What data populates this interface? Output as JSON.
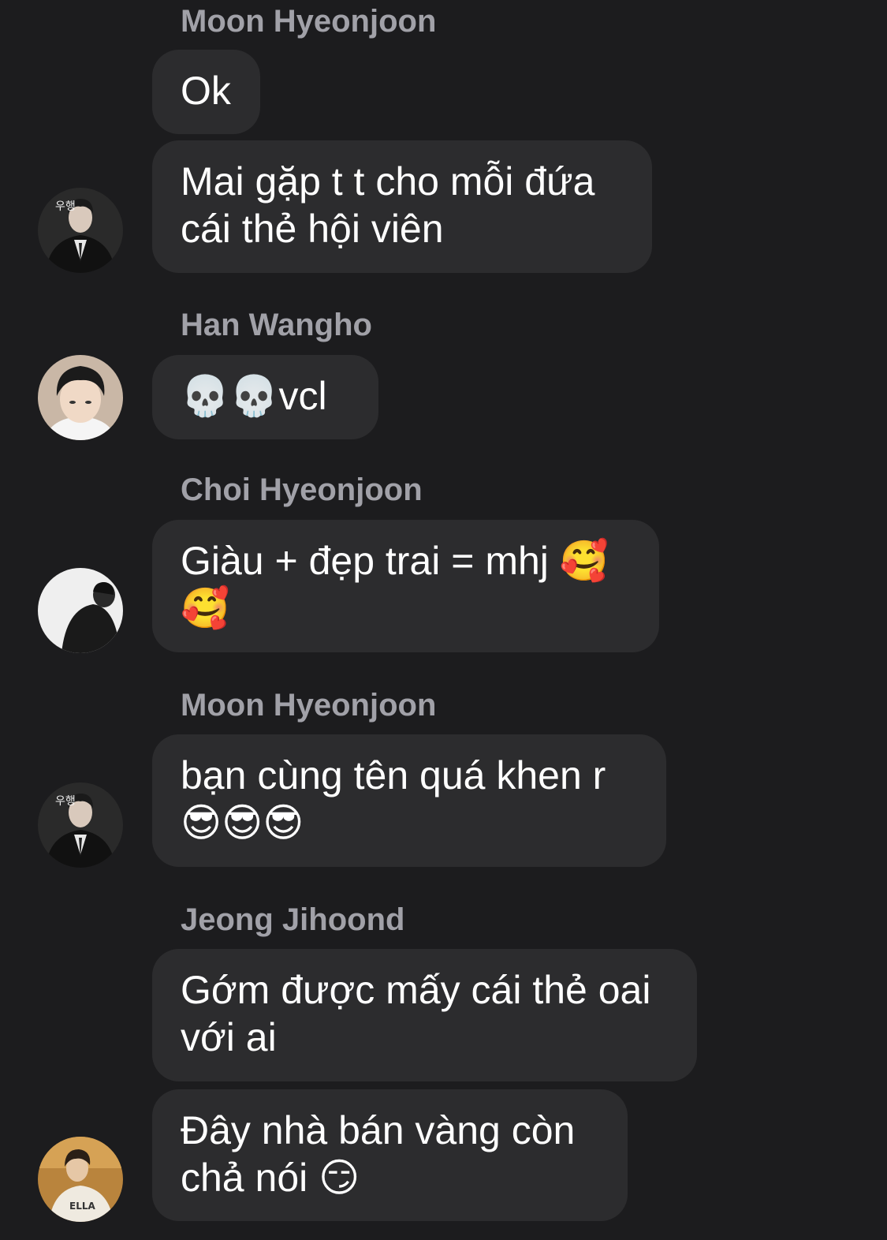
{
  "messages": [
    {
      "sender": "Moon Hyeonjoon"
    },
    {
      "text": "Ok"
    },
    {
      "text": "Mai gặp t t cho mỗi đứa\ncái thẻ hội viên"
    },
    {
      "sender": "Han Wangho"
    },
    {
      "text": "💀💀vcl"
    },
    {
      "sender": "Choi Hyeonjoon"
    },
    {
      "text": "Giàu + đẹp trai = mhj 🥰\n🥰"
    },
    {
      "sender": "Moon Hyeonjoon"
    },
    {
      "text": "bạn cùng tên quá khen r\n😎😎😎"
    },
    {
      "sender": "Jeong Jihoond"
    },
    {
      "text": "Gớm được mấy cái thẻ oai\nvới ai"
    },
    {
      "text": "Đây nhà bán vàng còn\nchả nói 😏"
    }
  ],
  "avatar_text": {
    "moon_1": "우행",
    "moon_2": "우행",
    "jeong": "ELLA"
  }
}
